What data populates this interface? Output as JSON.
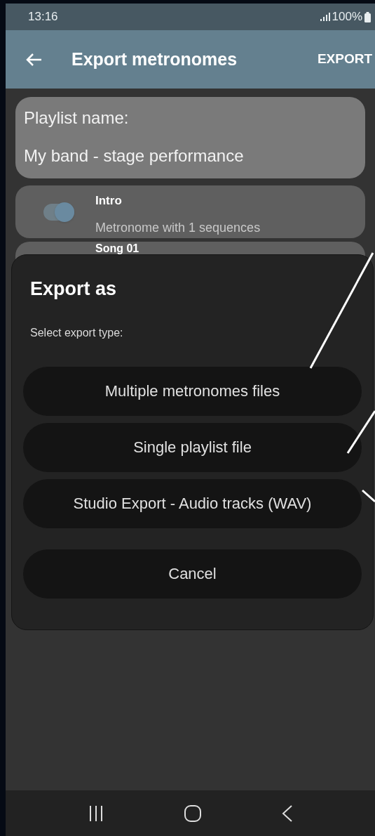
{
  "status_bar": {
    "time": "13:16",
    "battery": "100%"
  },
  "app_bar": {
    "title": "Export metronomes",
    "action": "EXPORT"
  },
  "playlist": {
    "label": "Playlist name:",
    "value": "My band - stage performance"
  },
  "metronomes": [
    {
      "name": "Intro",
      "subtitle": "Metronome with 1 sequences",
      "on": true
    },
    {
      "name": "Song 01"
    }
  ],
  "dialog": {
    "title": "Export as",
    "message": "Select export type:",
    "options": [
      "Multiple metronomes files",
      "Single playlist file",
      "Studio Export - Audio tracks (WAV)"
    ],
    "cancel": "Cancel"
  }
}
